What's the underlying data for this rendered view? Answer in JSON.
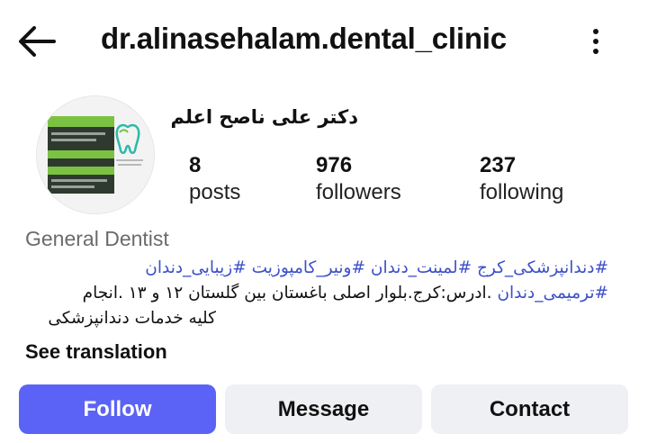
{
  "header": {
    "username": "dr.alinasehalam.dental_clinic",
    "back_icon": "arrow-left-icon",
    "more_icon": "more-vertical-icon"
  },
  "profile": {
    "display_name": "دکتر علی ناصح اعلم",
    "avatar_icon": "tooth-logo-icon",
    "stats": [
      {
        "value": "8",
        "label": "posts"
      },
      {
        "value": "976",
        "label": "followers"
      },
      {
        "value": "237",
        "label": "following"
      }
    ],
    "category": "General Dentist",
    "bio": {
      "line1": "#دندانپزشکی_کرج #لمینت_دندان #ونیر_کامپوزیت #زیبایی_دندان",
      "line2_tag": "#ترمیمی_دندان",
      "line2_text": " .ادرس:کرج.بلوار اصلی باغستان بین گلستان ۱۲ و ۱۳ .انجام",
      "line3": "کلیه خدمات دندانپزشکی"
    },
    "see_translation": "See translation"
  },
  "actions": {
    "follow": "Follow",
    "message": "Message",
    "contact": "Contact"
  },
  "colors": {
    "accent": "#5b63f6",
    "hashtag": "#3b4fc8",
    "secondary_button": "#eef0f3"
  }
}
